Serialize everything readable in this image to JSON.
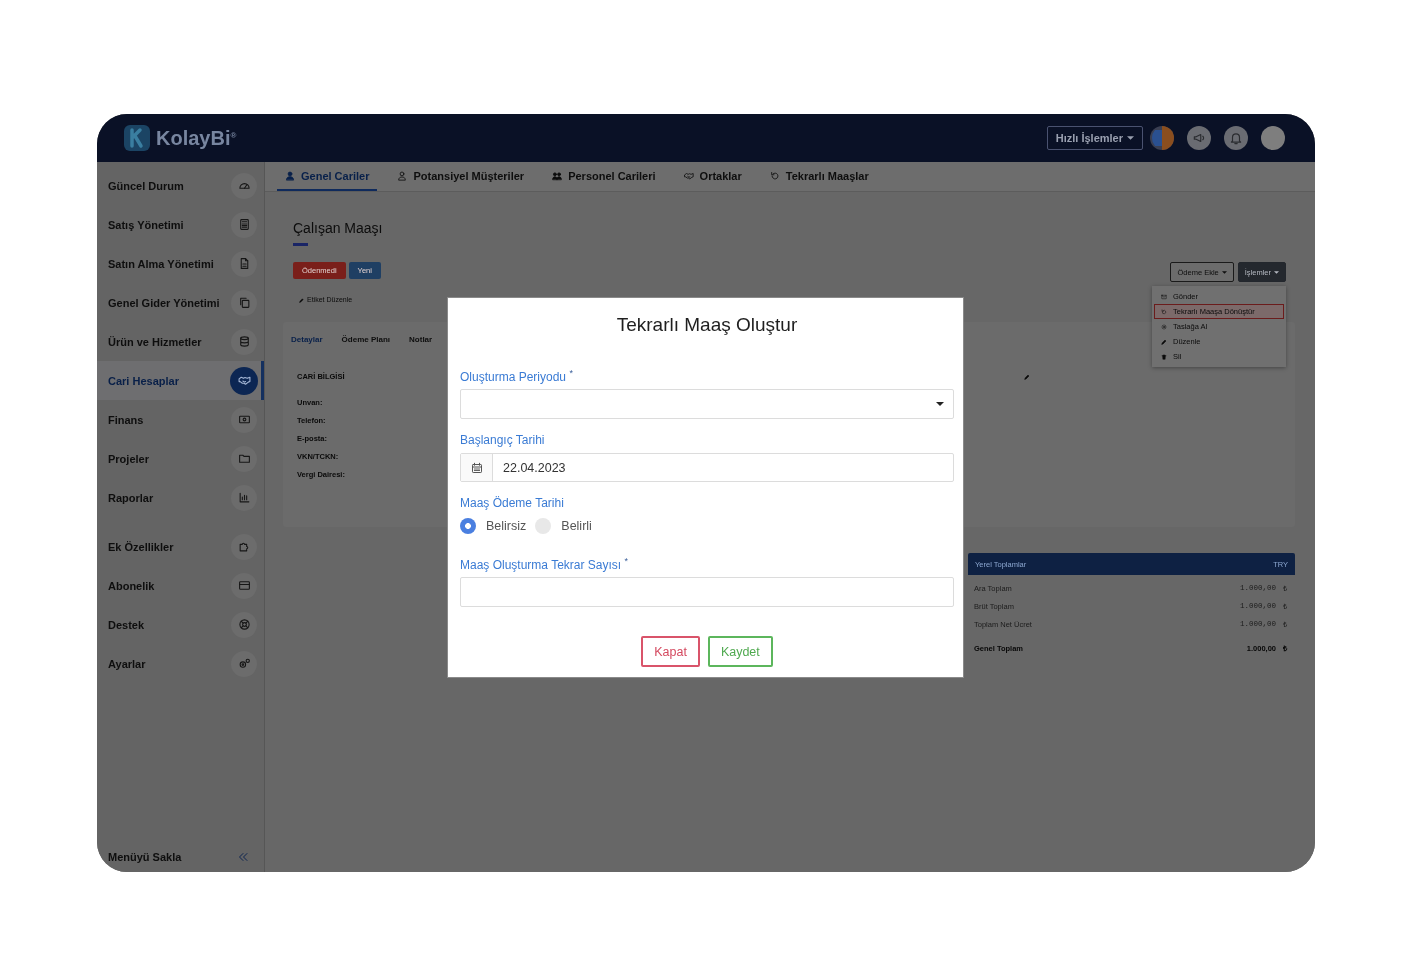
{
  "header": {
    "logo": "KolayBi$^{®}$",
    "quick_actions": "Hızlı İşlemler"
  },
  "sidebar": {
    "groups": [
      {
        "items": [
          {
            "label": "Güncel Durum",
            "selected": false
          },
          {
            "label": "Satış Yönetimi",
            "selected": false
          },
          {
            "label": "Satın Alma Yönetimi",
            "selected": false
          },
          {
            "label": "Genel Gider Yönetimi",
            "selected": false
          },
          {
            "label": "Ürün ve Hizmetler",
            "selected": false
          },
          {
            "label": "Cari Hesaplar",
            "selected": true
          },
          {
            "label": "Finans",
            "selected": false
          },
          {
            "label": "Projeler",
            "selected": false
          },
          {
            "label": "Raporlar",
            "selected": false
          }
        ]
      },
      {
        "items": [
          {
            "label": "Ek Özellikler",
            "selected": false
          },
          {
            "label": "Abonelik",
            "selected": false
          },
          {
            "label": "Destek",
            "selected": false
          },
          {
            "label": "Ayarlar",
            "selected": false
          }
        ]
      }
    ],
    "collapse": "Menüyü Sakla"
  },
  "tabs": [
    {
      "label": "Genel Cariler",
      "selected": true
    },
    {
      "label": "Potansiyel Müşteriler",
      "selected": false
    },
    {
      "label": "Personel Carileri",
      "selected": false
    },
    {
      "label": "Ortaklar",
      "selected": false
    },
    {
      "label": "Tekrarlı Maaşlar",
      "selected": false
    }
  ],
  "page": {
    "title": "Çalışan Maaşı",
    "badges": [
      {
        "label": "Ödenmedi",
        "color": "#7a1f1a"
      },
      {
        "label": "Yeni",
        "color": "#1f3f63"
      }
    ],
    "edit_tags": "Etiket Düzenle",
    "subtabs": [
      {
        "label": "Detaylar",
        "selected": true
      },
      {
        "label": "Ödeme Planı",
        "selected": false
      },
      {
        "label": "Notlar",
        "selected": false
      }
    ],
    "section_title": "CARİ BİLGİSİ",
    "fields": [
      "Unvan:",
      "Telefon:",
      "E-posta:",
      "VKN/TCKN:",
      "Vergi Dairesi:"
    ]
  },
  "actions": {
    "buttons": [
      {
        "label": "Ödeme Ekle",
        "kind": "outline"
      },
      {
        "label": "İşlemler",
        "kind": "dark"
      }
    ],
    "menu": [
      {
        "label": "Gönder",
        "selected": false
      },
      {
        "label": "Tekrarlı Maaşa Dönüştür",
        "selected": true
      },
      {
        "label": "Taslağa Al",
        "selected": false
      },
      {
        "label": "Düzenle",
        "selected": false
      },
      {
        "label": "Sil",
        "selected": false
      }
    ]
  },
  "totals": {
    "title": "Yerel Toplamlar",
    "currency": "TRY",
    "rows": [
      {
        "kind": "sub",
        "label": "Ara Toplam",
        "value": "1.000,00",
        "symbol": "₺"
      },
      {
        "kind": "sub",
        "label": "Brüt Toplam",
        "value": "1.000,00",
        "symbol": "₺"
      },
      {
        "kind": "sub",
        "label": "Toplam Net Ücret",
        "value": "1.000,00",
        "symbol": "₺"
      },
      {
        "kind": "grand",
        "label": "Genel Toplam",
        "value": "1.000,00",
        "symbol": "₺"
      }
    ]
  },
  "modal": {
    "title": "Tekrarlı Maaş Oluştur",
    "fields": [
      {
        "kind": "select",
        "label": "Oluşturma Periyodu $^{*}$"
      },
      {
        "kind": "date",
        "label": "Başlangıç Tarihi",
        "value": "22.04.2023"
      },
      {
        "kind": "radio",
        "label": "Maaş Ödeme Tarihi",
        "options": [
          {
            "label": "Belirsiz",
            "selected": true
          },
          {
            "label": "Belirli",
            "selected": false
          }
        ]
      },
      {
        "kind": "text",
        "label": "Maaş Oluşturma Tekrar Sayısı $^{*}$"
      }
    ],
    "buttons": [
      {
        "label": "Kapat",
        "kind": "cancel"
      },
      {
        "label": "Kaydet",
        "kind": "save"
      }
    ]
  }
}
